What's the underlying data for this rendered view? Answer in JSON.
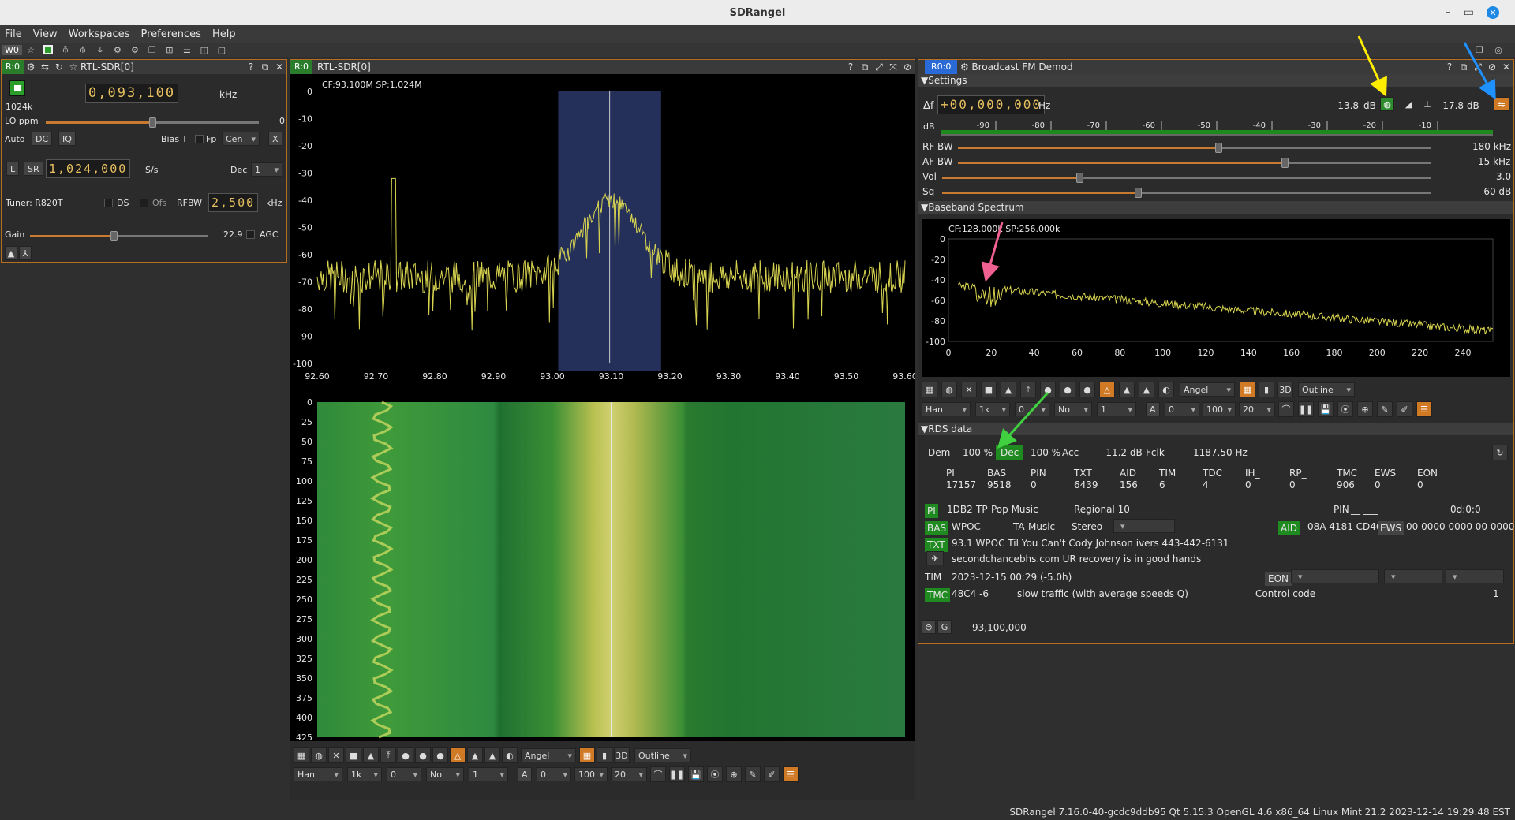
{
  "window": {
    "title": "SDRangel"
  },
  "menu": [
    "File",
    "View",
    "Workspaces",
    "Preferences",
    "Help"
  ],
  "workspace_label": "W0",
  "device_panel": {
    "badge": "R:0",
    "title": "RTL-SDR[0]",
    "freq_lcd": "0,093,100",
    "freq_unit": "kHz",
    "sample_label": "1024k",
    "lo_ppm_label": "LO ppm",
    "lo_ppm_value": "0",
    "auto_label": "Auto",
    "dc_label": "DC",
    "iq_label": "IQ",
    "biast_label": "Bias T",
    "fp_label": "Fp",
    "cen_value": "Cen",
    "x_label": "X",
    "l_label": "L",
    "sr_label": "SR",
    "sr_lcd": "1,024,000",
    "sr_unit": "S/s",
    "dec_label": "Dec",
    "dec_value": "1",
    "tuner_label": "Tuner: R820T",
    "ds_label": "DS",
    "ofs_label": "Ofs",
    "rfbw_label": "RFBW",
    "rfbw_lcd": "2,500",
    "rfbw_unit": "kHz",
    "gain_label": "Gain",
    "gain_value": "22.9",
    "agc_label": "AGC",
    "lo_ppm_level": 0.5,
    "gain_level": 0.47
  },
  "spectrum_panel": {
    "badge": "R:0",
    "title": "RTL-SDR[0]",
    "cf_label": "CF:93.100M SP:1.024M",
    "y_ticks": [
      "0",
      "-10",
      "-20",
      "-30",
      "-40",
      "-50",
      "-60",
      "-70",
      "-80",
      "-90",
      "-100"
    ],
    "x_ticks": [
      "92.60",
      "92.70",
      "92.80",
      "92.90",
      "93.00",
      "93.10",
      "93.20",
      "93.30",
      "93.40",
      "93.50",
      "93.60"
    ],
    "wf_ticks": [
      "0",
      "25",
      "50",
      "75",
      "100",
      "125",
      "150",
      "175",
      "200",
      "225",
      "250",
      "275",
      "300",
      "325",
      "350",
      "375",
      "400",
      "425"
    ],
    "palette": "Angel",
    "style": "Outline",
    "window_fn": "Han",
    "fft_size": "1k",
    "ref": "0",
    "no": "No",
    "avg": "1",
    "a_label": "A",
    "a_val": "0",
    "range": "100",
    "fps": "20"
  },
  "demod_panel": {
    "badge": "R0:0",
    "title": "Broadcast FM Demod",
    "settings_label": "Settings",
    "df_label": "Δf",
    "df_lcd": "+00,000,000",
    "df_unit": "Hz",
    "db_level_1": "-13.8",
    "db_unit": "dB",
    "db_level_2": "-17.8 dB",
    "db_scale_label": "dB",
    "meter_ticks": [
      "-90",
      "-80",
      "-70",
      "-60",
      "-50",
      "-40",
      "-30",
      "-20",
      "-10"
    ],
    "rfbw_label": "RF BW",
    "rfbw_value": "180 kHz",
    "afbw_label": "AF BW",
    "afbw_value": "15 kHz",
    "vol_label": "Vol",
    "vol_value": "3.0",
    "sq_label": "Sq",
    "sq_value": "-60 dB",
    "baseband_label": "Baseband Spectrum",
    "bb_cf_label": "CF:128.000k SP:256.000k",
    "bb_y_ticks": [
      "0",
      "-20",
      "-40",
      "-60",
      "-80",
      "-100"
    ],
    "bb_x_ticks": [
      "0",
      "20",
      "40",
      "60",
      "80",
      "100",
      "120",
      "140",
      "160",
      "180",
      "200",
      "220",
      "240"
    ],
    "palette": "Angel",
    "style": "Outline",
    "window_fn": "Han",
    "fft_size": "1k",
    "ref": "0",
    "no": "No",
    "avg": "1",
    "a_label": "A",
    "a_val": "0",
    "range": "100",
    "fps": "20",
    "rds_label": "RDS data",
    "dem_label": "Dem",
    "dem_value": "100 %",
    "dec_label": "Dec",
    "dec_value": "100 %",
    "acc_label": "Acc",
    "acc_value": "-11.2 dB",
    "fclk_label": "Fclk",
    "fclk_value": "1187.50 Hz",
    "counters_head": [
      "PI",
      "BAS",
      "PIN",
      "TXT",
      "AID",
      "TIM",
      "TDC",
      "IH_",
      "RP_",
      "TMC",
      "EWS",
      "EON"
    ],
    "counters_vals": [
      "17157",
      "9518",
      "0",
      "6439",
      "156",
      "6",
      "4",
      "0",
      "0",
      "906",
      "0",
      "0"
    ],
    "pi_label": "PI",
    "pi_value": "1DB2",
    "tp_label": "TP",
    "pty": "Pop Music",
    "region": "Regional 10",
    "pin_label": "PIN",
    "pin_value": "__ ___",
    "pin_time": "0d:0:0",
    "bas_label": "BAS",
    "bas_value": "WPOC",
    "ta_label": "TA",
    "music_label": "Music",
    "stereo_label": "Stereo",
    "aid_label": "AID",
    "aid_value": "08A 4181 CD46",
    "ews_label": "EWS",
    "ews_value": "00 0000 0000 00 0000",
    "txt_label": "TXT",
    "txt_value": "93.1 WPOC Til You Can't Cody Johnson    ivers  443-442-6131",
    "txt_value2": "secondchancebhs.com UR recovery is in good hands",
    "tim_label": "TIM",
    "tim_value": "2023-12-15 00:29 (-5.0h)",
    "eon_label": "EON",
    "tmc_label": "TMC",
    "tmc_value": "48C4  -6",
    "tmc_event": "slow traffic (with average speeds Q)",
    "tmc_ctrl_label": "Control code",
    "tmc_ctrl_value": "1",
    "footer_freq": "93,100,000",
    "rfbw_level": 0.55,
    "afbw_level": 0.69,
    "vol_level": 0.28,
    "sq_level": 0.4
  },
  "status": "SDRangel 7.16.0-40-gcdc9ddb95 Qt 5.15.3 OpenGL 4.6 x86_64 Linux Mint 21.2  2023-12-14 19:29:48 EST",
  "colors": {
    "accent": "#c77a30",
    "badge_green": "#2a7d2a",
    "badge_blue": "#2a6ad6",
    "trace": "#d8d450",
    "annot_yellow": "#ffee00",
    "annot_blue": "#1e90ff",
    "annot_pink": "#f06090",
    "annot_green": "#40d040"
  }
}
